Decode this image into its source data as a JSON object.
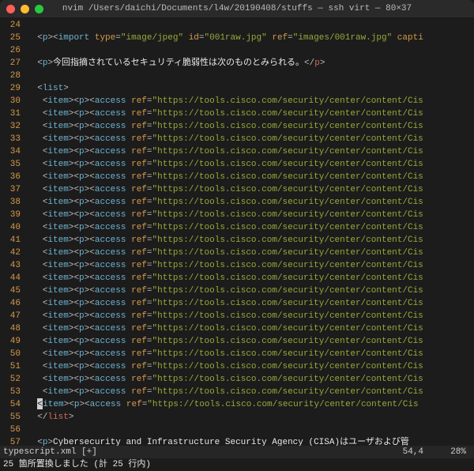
{
  "titlebar": {
    "title": "nvim  /Users/daichi/Documents/l4w/20190408/stuffs — ssh virt — 80×37"
  },
  "editor": {
    "first_visible_line": 24,
    "cursor_line": 54,
    "total_visible_lines": 34,
    "lines": [
      {
        "num": 24,
        "kind": "blank"
      },
      {
        "num": 25,
        "kind": "import"
      },
      {
        "num": 26,
        "kind": "blank"
      },
      {
        "num": 27,
        "kind": "para_jp"
      },
      {
        "num": 28,
        "kind": "blank"
      },
      {
        "num": 29,
        "kind": "list_open"
      },
      {
        "num": 30,
        "kind": "item"
      },
      {
        "num": 31,
        "kind": "item"
      },
      {
        "num": 32,
        "kind": "item"
      },
      {
        "num": 33,
        "kind": "item"
      },
      {
        "num": 34,
        "kind": "item"
      },
      {
        "num": 35,
        "kind": "item"
      },
      {
        "num": 36,
        "kind": "item"
      },
      {
        "num": 37,
        "kind": "item"
      },
      {
        "num": 38,
        "kind": "item"
      },
      {
        "num": 39,
        "kind": "item"
      },
      {
        "num": 40,
        "kind": "item"
      },
      {
        "num": 41,
        "kind": "item"
      },
      {
        "num": 42,
        "kind": "item"
      },
      {
        "num": 43,
        "kind": "item"
      },
      {
        "num": 44,
        "kind": "item"
      },
      {
        "num": 45,
        "kind": "item"
      },
      {
        "num": 46,
        "kind": "item"
      },
      {
        "num": 47,
        "kind": "item"
      },
      {
        "num": 48,
        "kind": "item"
      },
      {
        "num": 49,
        "kind": "item"
      },
      {
        "num": 50,
        "kind": "item"
      },
      {
        "num": 51,
        "kind": "item"
      },
      {
        "num": 52,
        "kind": "item"
      },
      {
        "num": 53,
        "kind": "item"
      },
      {
        "num": 54,
        "kind": "item_cursor"
      },
      {
        "num": 55,
        "kind": "list_close"
      },
      {
        "num": 56,
        "kind": "blank"
      },
      {
        "num": 57,
        "kind": "para_en"
      }
    ],
    "content": {
      "import_line": {
        "indent": "  ",
        "tag_p": "p",
        "tag_import": "import",
        "attrs": [
          [
            "type",
            "\"image/jpeg\""
          ],
          [
            "id",
            "\"001raw.jpg\""
          ],
          [
            "ref",
            "\"images/001raw.jpg\""
          ]
        ],
        "trailing_attr": "capti"
      },
      "para_jp": {
        "indent": "  ",
        "tag": "p",
        "text": "今回指摘されているセキュリティ脆弱性は次のものとみられる。"
      },
      "list_open": {
        "indent": "  ",
        "tag": "list"
      },
      "list_close": {
        "indent": "  ",
        "tag": "list"
      },
      "item": {
        "indent": "   ",
        "tags": [
          "item",
          "p",
          "access"
        ],
        "ref_attr": "ref",
        "ref_val": "\"https://tools.cisco.com/security/center/content/Cis"
      },
      "para_en": {
        "indent": "  ",
        "tag": "p",
        "text": "Cybersecurity and Infrastructure Security Agency (CISA)はユーザおよび管"
      }
    }
  },
  "status": {
    "filename": "typescript.xml",
    "modified_flag": "[+]",
    "position": "54,4",
    "percent": "28%",
    "message": "25 箇所置換しました (計 25 行内)"
  }
}
